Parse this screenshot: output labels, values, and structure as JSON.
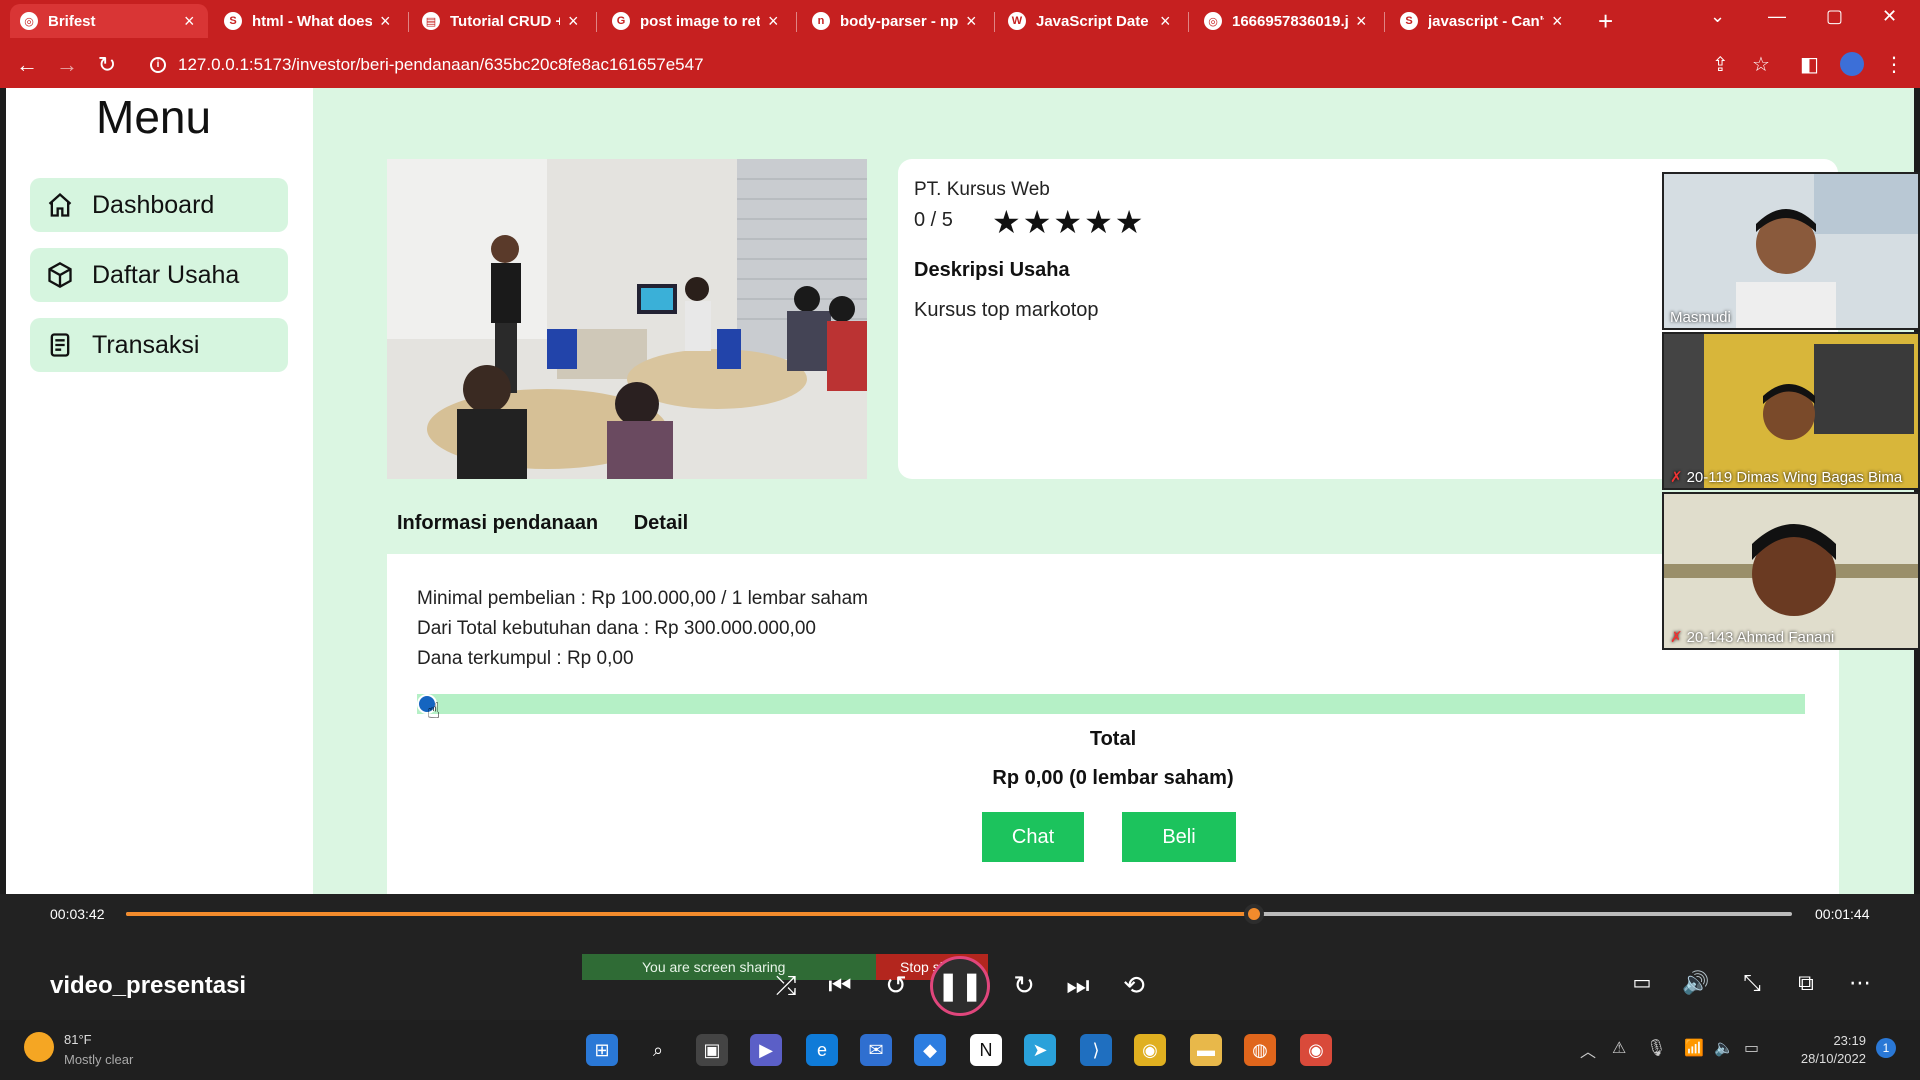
{
  "browser": {
    "tabs": [
      {
        "label": "Brifest",
        "icon": "globe-icon",
        "active": true
      },
      {
        "label": "html - What does",
        "icon": "stackoverflow-icon"
      },
      {
        "label": "Tutorial CRUD + ",
        "icon": "page-icon"
      },
      {
        "label": "post image to ret",
        "icon": "google-icon"
      },
      {
        "label": "body-parser - np",
        "icon": "npm-icon"
      },
      {
        "label": "JavaScript Date g",
        "icon": "w3schools-icon"
      },
      {
        "label": "1666957836019.j",
        "icon": "globe-icon"
      },
      {
        "label": "javascript - Can't",
        "icon": "stackoverflow-icon"
      }
    ],
    "url": "127.0.0.1:5173/investor/beri-pendanaan/635bc20c8fe8ac161657e547"
  },
  "sidebar": {
    "title": "Menu",
    "items": [
      {
        "label": "Dashboard",
        "icon": "home-icon"
      },
      {
        "label": "Daftar Usaha",
        "icon": "box-icon"
      },
      {
        "label": "Transaksi",
        "icon": "document-icon"
      }
    ]
  },
  "business": {
    "name": "PT. Kursus Web",
    "rating_text": "0 / 5",
    "rating_value": 0,
    "stars": "★★★★★",
    "description_heading": "Deskripsi Usaha",
    "description": "Kursus top markotop"
  },
  "tabs": {
    "info": "Informasi pendanaan",
    "detail": "Detail"
  },
  "funding": {
    "min_purchase": "Minimal pembelian : Rp 100.000,00 / 1 lembar saham",
    "total_need": "Dari Total kebutuhan dana : Rp 300.000.000,00",
    "collected": "Dana terkumpul : Rp 0,00",
    "slider_value": 0,
    "total_heading": "Total",
    "total_value": "Rp 0,00 (0 lembar saham)",
    "chat_label": "Chat",
    "buy_label": "Beli",
    "accent_color": "#1cc35d"
  },
  "video_call": {
    "participants": [
      {
        "name": "Masmudi",
        "muted": false
      },
      {
        "name": "20-119 Dimas Wing Bagas Bima",
        "muted": true
      },
      {
        "name": "20-143 Ahmad Fanani",
        "muted": true
      }
    ]
  },
  "player": {
    "elapsed": "00:03:42",
    "remaining": "00:01:44",
    "progress": 0.677,
    "title": "video_presentasi",
    "sharing_text": "You are screen sharing",
    "stop_share": "Stop share",
    "accent_color": "#f28b2c"
  },
  "taskbar": {
    "temperature": "81°F",
    "condition": "Mostly clear",
    "time": "23:19",
    "date": "28/10/2022"
  }
}
